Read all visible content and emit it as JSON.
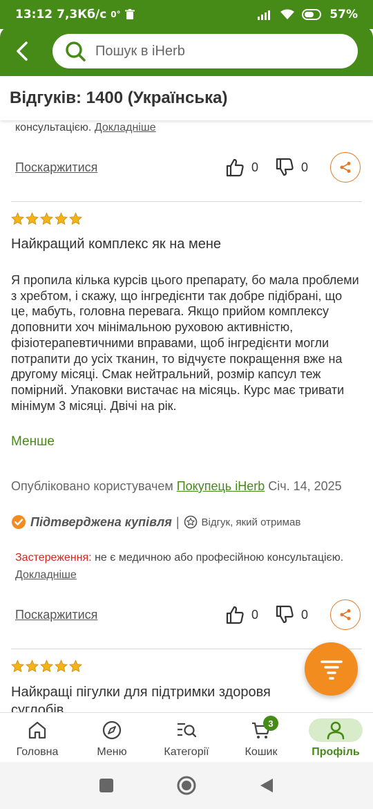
{
  "status_bar": {
    "time": "13:12",
    "speed": "7,3Кб/с",
    "degree": "0°",
    "battery": "57%"
  },
  "search": {
    "placeholder": "Пошук в iHerb"
  },
  "page": {
    "title": "Відгуків: 1400 (Українська)"
  },
  "review_prev": {
    "disclaimer_text": "консультацією.",
    "more_link": "Докладніше",
    "report_label": "Поскаржитися",
    "likes": "0",
    "dislikes": "0"
  },
  "review": {
    "rating": 5,
    "title": "Найкращий комплекс як на мене",
    "body": "Я пропила кілька курсів цього препарату, бо мала проблеми з хребтом, і скажу, що інгредієнти так добре підібрані, що це, мабуть, головна перевага. Якщо прийом комплексу доповнити хоч мінімальною руховою активністю, фізіотерапевтичними вправами, щоб інгредієнти могли потрапити до усіх тканин, то відчуєте покращення вже на другому місяці. Смак нейтральний, розмір капсул теж помірний. Упаковки вистачає на місяць. Курс має тривати мінімум 3 місяці. Двічі на рік.",
    "less_link": "Менше",
    "published_prefix": "Опубліковано користувачем",
    "author": "Покупець iHerb",
    "date": "Січ. 14, 2025",
    "verified_label": "Підтверджена купівля",
    "separator": "|",
    "incentive_label": "Відгук, який отримав",
    "warning_label": "Застереження:",
    "warning_text": "не є медичною або професійною консультацією.",
    "more_link": "Докладніше",
    "report_label": "Поскаржитися",
    "likes": "0",
    "dislikes": "0"
  },
  "review_next": {
    "rating": 5,
    "title": "Найкращі пігулки для підтримки здоровя суглобів"
  },
  "bottom_nav": {
    "items": [
      {
        "label": "Головна",
        "icon": "home-icon"
      },
      {
        "label": "Меню",
        "icon": "compass-icon"
      },
      {
        "label": "Категорії",
        "icon": "categories-search-icon"
      },
      {
        "label": "Кошик",
        "icon": "cart-icon",
        "badge": "3"
      },
      {
        "label": "Профіль",
        "icon": "profile-icon",
        "active": true
      }
    ]
  },
  "colors": {
    "brand_green": "#468a17",
    "accent_orange": "#f28c1e",
    "star_gold": "#f5b31a",
    "warning_red": "#d0271d"
  }
}
